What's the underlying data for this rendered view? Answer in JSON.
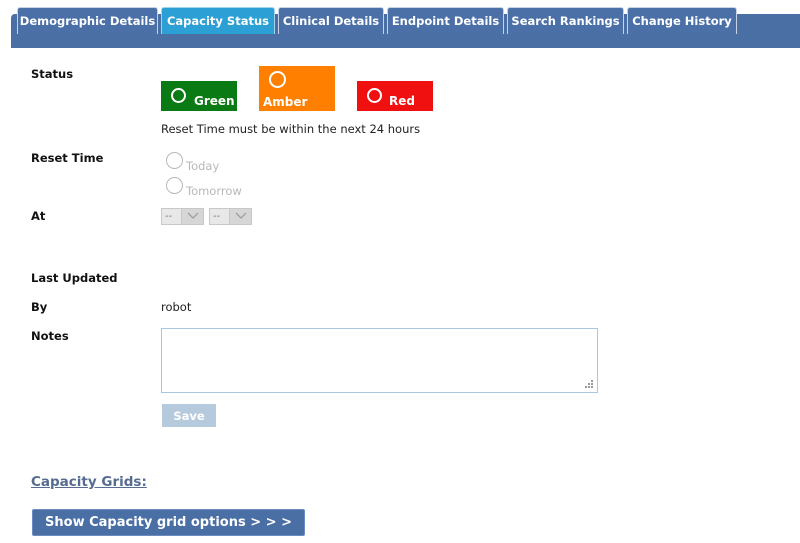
{
  "tabs": [
    {
      "label": "Demographic Details",
      "active": false
    },
    {
      "label": "Capacity Status",
      "active": true
    },
    {
      "label": "Clinical Details",
      "active": false
    },
    {
      "label": "Endpoint Details",
      "active": false
    },
    {
      "label": "Search Rankings",
      "active": false
    },
    {
      "label": "Change History",
      "active": false
    }
  ],
  "status": {
    "label": "Status",
    "options": [
      {
        "label": "Green",
        "color": "#0a7a14"
      },
      {
        "label": "Amber",
        "color": "#ff7f00"
      },
      {
        "label": "Red",
        "color": "#f01010"
      }
    ],
    "hint": "Reset Time must be within the next 24 hours"
  },
  "reset_time": {
    "label": "Reset Time",
    "options": [
      "Today",
      "Tomorrow"
    ]
  },
  "at": {
    "label": "At",
    "hour_value": "--",
    "minute_value": "--"
  },
  "last_updated": {
    "label": "Last Updated",
    "value": ""
  },
  "by": {
    "label": "By",
    "value": "robot"
  },
  "notes": {
    "label": "Notes",
    "value": ""
  },
  "save_label": "Save",
  "capacity_grids": {
    "link_label": "Capacity Grids:",
    "button_label": "Show Capacity grid options > > >"
  }
}
